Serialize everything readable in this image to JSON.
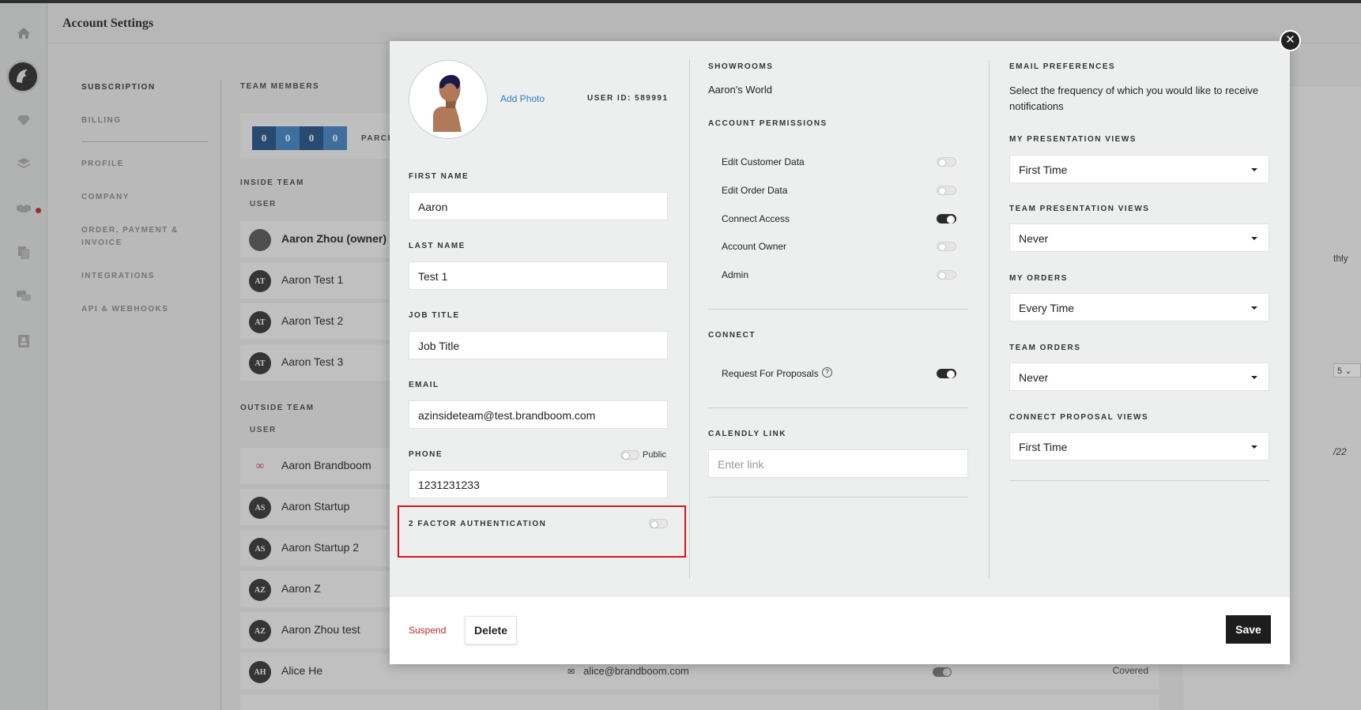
{
  "header": {
    "title": "Account Settings"
  },
  "rail": {
    "icons": [
      "home-icon",
      "brand-logo",
      "diamond-icon",
      "layers-icon",
      "handshake-icon",
      "documents-icon",
      "chat-icon",
      "contacts-icon"
    ]
  },
  "subnav": {
    "items": [
      "SUBSCRIPTION",
      "BILLING",
      "PROFILE",
      "COMPANY",
      "ORDER, PAYMENT & INVOICE",
      "INTEGRATIONS",
      "API & WEBHOOKS"
    ]
  },
  "team": {
    "title": "TEAM MEMBERS",
    "seats": [
      "0",
      "0",
      "0",
      "0"
    ],
    "parcel": "PARCE",
    "inside_title": "INSIDE TEAM",
    "outside_title": "OUTSIDE TEAM",
    "user_col": "USER",
    "inside": [
      {
        "initials": "",
        "name": "Aaron Zhou (owner)"
      },
      {
        "initials": "AT",
        "name": "Aaron Test 1"
      },
      {
        "initials": "AT",
        "name": "Aaron Test 2"
      },
      {
        "initials": "AT",
        "name": "Aaron Test 3"
      }
    ],
    "outside": [
      {
        "initials": "",
        "name": "Aaron Brandboom"
      },
      {
        "initials": "AS",
        "name": "Aaron Startup"
      },
      {
        "initials": "AS",
        "name": "Aaron Startup 2"
      },
      {
        "initials": "AZ",
        "name": "Aaron Z"
      },
      {
        "initials": "AZ",
        "name": "Aaron Zhou test"
      },
      {
        "initials": "AH",
        "name": "Alice He",
        "email": "alice@brandboom.com",
        "status": "Covered"
      }
    ]
  },
  "right_panel": {
    "frag1": "thly",
    "frag2": "5",
    "frag3": "/22"
  },
  "modal": {
    "add_photo": "Add Photo",
    "user_id": "USER ID: 589991",
    "first_name": {
      "label": "FIRST NAME",
      "value": "Aaron"
    },
    "last_name": {
      "label": "LAST NAME",
      "value": "Test 1"
    },
    "job_title": {
      "label": "JOB TITLE",
      "value": "Job Title"
    },
    "email": {
      "label": "EMAIL",
      "value": "azinsideteam@test.brandboom.com"
    },
    "phone": {
      "label": "PHONE",
      "value": "1231231233",
      "public_label": "Public"
    },
    "two_factor": {
      "label": "2 FACTOR AUTHENTICATION"
    },
    "showrooms": {
      "label": "SHOWROOMS",
      "value": "Aaron's World"
    },
    "permissions": {
      "label": "ACCOUNT PERMISSIONS",
      "items": [
        {
          "name": "Edit Customer Data",
          "on": false
        },
        {
          "name": "Edit Order Data",
          "on": false
        },
        {
          "name": "Connect Access",
          "on": true
        },
        {
          "name": "Account Owner",
          "on": false
        },
        {
          "name": "Admin",
          "on": false
        }
      ]
    },
    "connect": {
      "label": "CONNECT",
      "rfp_label": "Request For Proposals",
      "rfp_on": true
    },
    "calendly": {
      "label": "CALENDLY LINK",
      "placeholder": "Enter link"
    },
    "email_prefs": {
      "label": "EMAIL PREFERENCES",
      "description": "Select the frequency of which you would like to receive notifications",
      "items": [
        {
          "label": "MY PRESENTATION VIEWS",
          "value": "First Time"
        },
        {
          "label": "TEAM PRESENTATION VIEWS",
          "value": "Never"
        },
        {
          "label": "MY ORDERS",
          "value": "Every Time"
        },
        {
          "label": "TEAM ORDERS",
          "value": "Never"
        },
        {
          "label": "CONNECT PROPOSAL VIEWS",
          "value": "First Time"
        }
      ]
    },
    "footer": {
      "suspend": "Suspend",
      "delete": "Delete",
      "save": "Save"
    }
  },
  "colors": {
    "accent_link": "#2b7fc8",
    "danger": "#c0272d",
    "highlight_box": "#d9161e",
    "seat_dark": "#1f4f86",
    "seat_light": "#3d82c4"
  }
}
